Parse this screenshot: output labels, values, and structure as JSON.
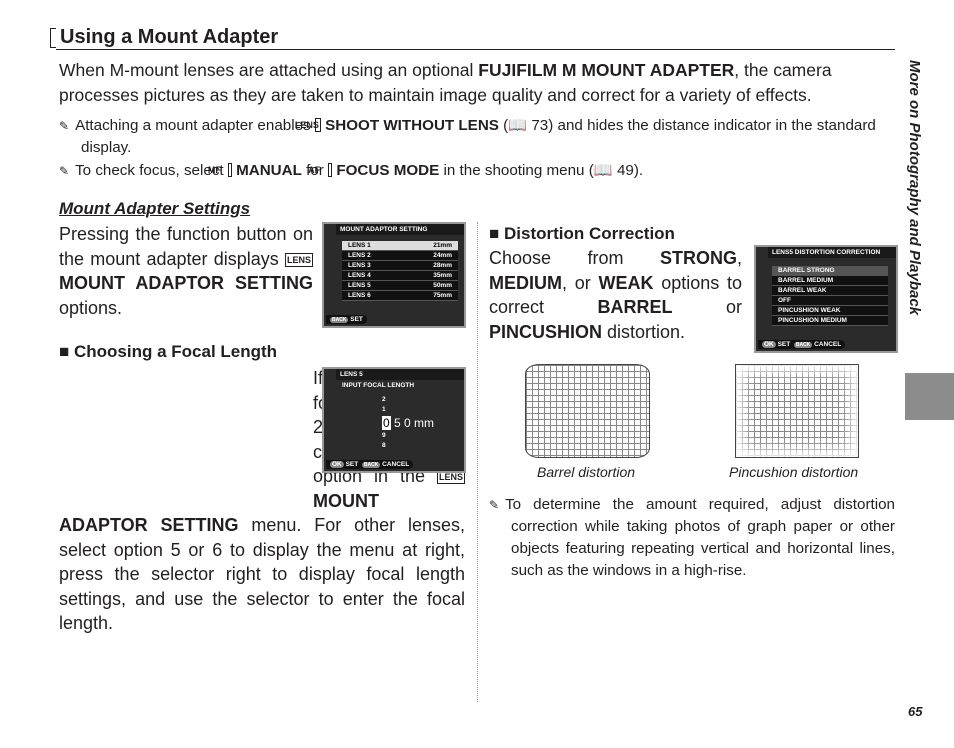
{
  "title": "Using a Mount Adapter",
  "intro": {
    "pre": "When M-mount lenses are attached using an optional ",
    "product": "FUJIFILM M MOUNT ADAPTER",
    "post": ", the camera processes pictures as they are taken to maintain image quality and correct for a variety of effects."
  },
  "notes": [
    {
      "a": "Attaching a mount adapter enables ",
      "icon": "LENS",
      "b": "SHOOT WITHOUT LENS",
      "c": " (",
      "ref": "73",
      "d": ") and hides the distance indicator in the standard display."
    },
    {
      "a": "To check focus, select ",
      "icon": "MF",
      "b": "MANUAL",
      "c": " for ",
      "icon2": "AF",
      "b2": "FOCUS MODE",
      "d": " in the shooting menu (",
      "ref": "49",
      "e": ")."
    }
  ],
  "left": {
    "heading": "Mount Adapter Settings",
    "p1": {
      "a": "Pressing the function button on the mount adapter displays ",
      "icon": "LENS",
      "b": "MOUNT ADAPTOR SETTING",
      "c": " options."
    },
    "h2": "Choosing a Focal Length",
    "p2": {
      "a": "If the lens has a focal length of 21, 24, 28, or 35 mm, choose a matching option in the ",
      "icon": "LENS",
      "b": "MOUNT ADAPTOR SETTING",
      "c": " menu.  For other lenses, select option 5 or 6 to display the menu at right, press the selector right to display focal length settings, and use the selector to enter the focal length."
    }
  },
  "screen1": {
    "title": "MOUNT ADAPTOR SETTING",
    "rows": [
      [
        "LENS 1",
        "21mm"
      ],
      [
        "LENS 2",
        "24mm"
      ],
      [
        "LENS 3",
        "28mm"
      ],
      [
        "LENS 4",
        "35mm"
      ],
      [
        "LENS 5",
        "50mm"
      ],
      [
        "LENS 6",
        "75mm"
      ]
    ],
    "foot": "SET",
    "foot_btn": "BACK"
  },
  "screen2": {
    "title": "LENS 5",
    "label": "INPUT FOCAL LENGTH",
    "up2": "2",
    "up1": "1",
    "digit": "0",
    "rest": "5 0 mm",
    "dn1": "9",
    "dn2": "8",
    "ok": "OK",
    "set": "SET",
    "back": "BACK",
    "cancel": "CANCEL"
  },
  "right": {
    "h": "Distortion Correction",
    "p": {
      "a": "Choose from ",
      "s": "STRONG",
      "m": "MEDIUM",
      "or": ", or ",
      "w": "WEAK",
      "b": " options to correct ",
      "barrel": "BARREL",
      "or2": " or ",
      "pin": "PINCUSHION",
      "c": " distortion."
    },
    "cap1": "Barrel distortion",
    "cap2": "Pincushion distortion",
    "note": "To determine the amount required, adjust distortion correction while taking photos of graph paper or other objects featuring repeating vertical and horizontal lines, such as the windows in a high-rise."
  },
  "screen3": {
    "title": "LENS5 DISTORTION CORRECTION",
    "rows": [
      "BARREL STRONG",
      "BARREL MEDIUM",
      "BARREL WEAK",
      "OFF",
      "PINCUSHION WEAK",
      "PINCUSHION MEDIUM"
    ],
    "ok": "OK",
    "set": "SET",
    "back": "BACK",
    "cancel": "CANCEL"
  },
  "side": "More on Photography and Playback",
  "page": "65"
}
